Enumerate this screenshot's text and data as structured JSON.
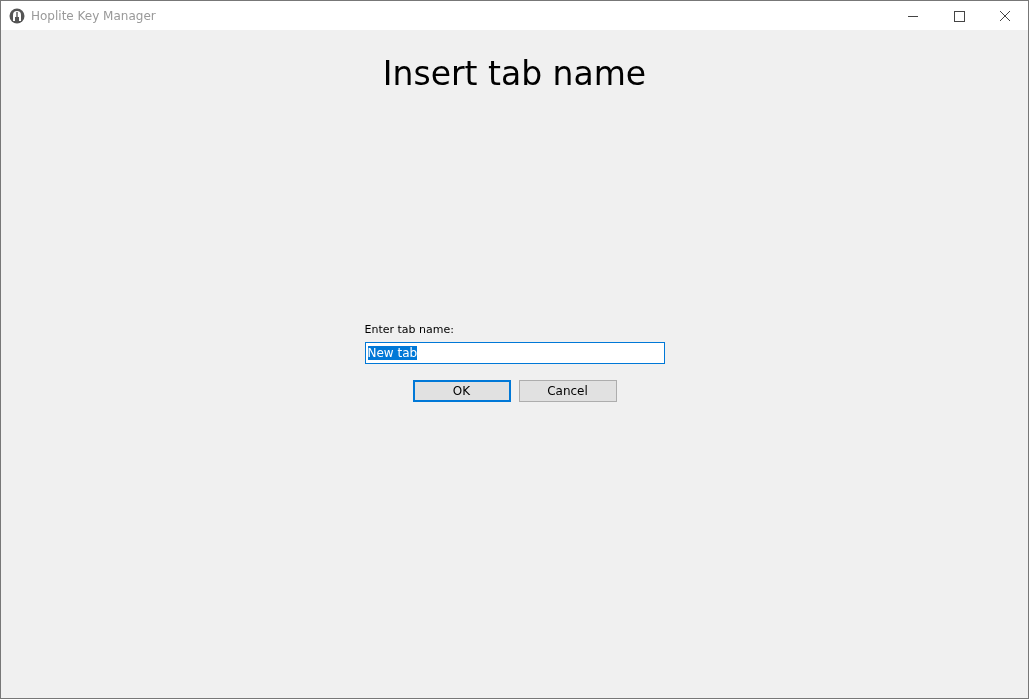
{
  "window": {
    "title": "Hoplite Key Manager"
  },
  "heading": "Insert tab name",
  "field": {
    "label": "Enter tab name:",
    "value": "New tab",
    "value_selected": true,
    "focused": true
  },
  "buttons": [
    {
      "label": "OK",
      "default": true
    },
    {
      "label": "Cancel",
      "default": false
    }
  ]
}
